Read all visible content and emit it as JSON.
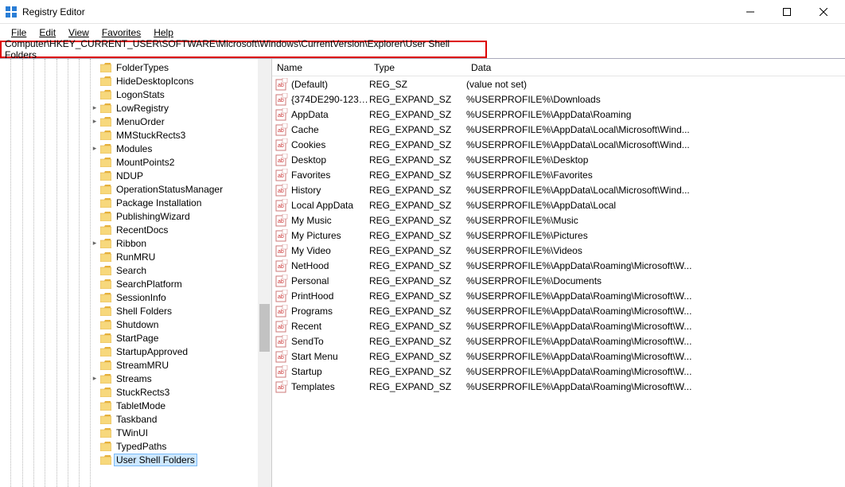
{
  "titlebar": {
    "title": "Registry Editor"
  },
  "menu": {
    "file": "File",
    "edit": "Edit",
    "view": "View",
    "favorites": "Favorites",
    "help": "Help"
  },
  "address": "Computer\\HKEY_CURRENT_USER\\SOFTWARE\\Microsoft\\Windows\\CurrentVersion\\Explorer\\User Shell Folders",
  "list": {
    "cols": {
      "name": "Name",
      "type": "Type",
      "data": "Data"
    },
    "rows": [
      {
        "name": "(Default)",
        "type": "REG_SZ",
        "data": "(value not set)"
      },
      {
        "name": "{374DE290-123F...",
        "type": "REG_EXPAND_SZ",
        "data": "%USERPROFILE%\\Downloads"
      },
      {
        "name": "AppData",
        "type": "REG_EXPAND_SZ",
        "data": "%USERPROFILE%\\AppData\\Roaming"
      },
      {
        "name": "Cache",
        "type": "REG_EXPAND_SZ",
        "data": "%USERPROFILE%\\AppData\\Local\\Microsoft\\Wind..."
      },
      {
        "name": "Cookies",
        "type": "REG_EXPAND_SZ",
        "data": "%USERPROFILE%\\AppData\\Local\\Microsoft\\Wind..."
      },
      {
        "name": "Desktop",
        "type": "REG_EXPAND_SZ",
        "data": "%USERPROFILE%\\Desktop"
      },
      {
        "name": "Favorites",
        "type": "REG_EXPAND_SZ",
        "data": "%USERPROFILE%\\Favorites"
      },
      {
        "name": "History",
        "type": "REG_EXPAND_SZ",
        "data": "%USERPROFILE%\\AppData\\Local\\Microsoft\\Wind..."
      },
      {
        "name": "Local AppData",
        "type": "REG_EXPAND_SZ",
        "data": "%USERPROFILE%\\AppData\\Local"
      },
      {
        "name": "My Music",
        "type": "REG_EXPAND_SZ",
        "data": "%USERPROFILE%\\Music"
      },
      {
        "name": "My Pictures",
        "type": "REG_EXPAND_SZ",
        "data": "%USERPROFILE%\\Pictures"
      },
      {
        "name": "My Video",
        "type": "REG_EXPAND_SZ",
        "data": "%USERPROFILE%\\Videos"
      },
      {
        "name": "NetHood",
        "type": "REG_EXPAND_SZ",
        "data": "%USERPROFILE%\\AppData\\Roaming\\Microsoft\\W..."
      },
      {
        "name": "Personal",
        "type": "REG_EXPAND_SZ",
        "data": "%USERPROFILE%\\Documents"
      },
      {
        "name": "PrintHood",
        "type": "REG_EXPAND_SZ",
        "data": "%USERPROFILE%\\AppData\\Roaming\\Microsoft\\W..."
      },
      {
        "name": "Programs",
        "type": "REG_EXPAND_SZ",
        "data": "%USERPROFILE%\\AppData\\Roaming\\Microsoft\\W..."
      },
      {
        "name": "Recent",
        "type": "REG_EXPAND_SZ",
        "data": "%USERPROFILE%\\AppData\\Roaming\\Microsoft\\W..."
      },
      {
        "name": "SendTo",
        "type": "REG_EXPAND_SZ",
        "data": "%USERPROFILE%\\AppData\\Roaming\\Microsoft\\W..."
      },
      {
        "name": "Start Menu",
        "type": "REG_EXPAND_SZ",
        "data": "%USERPROFILE%\\AppData\\Roaming\\Microsoft\\W..."
      },
      {
        "name": "Startup",
        "type": "REG_EXPAND_SZ",
        "data": "%USERPROFILE%\\AppData\\Roaming\\Microsoft\\W..."
      },
      {
        "name": "Templates",
        "type": "REG_EXPAND_SZ",
        "data": "%USERPROFILE%\\AppData\\Roaming\\Microsoft\\W..."
      }
    ]
  },
  "tree": [
    {
      "indent": 8,
      "exp": "",
      "label": "FolderTypes"
    },
    {
      "indent": 8,
      "exp": "",
      "label": "HideDesktopIcons"
    },
    {
      "indent": 8,
      "exp": "",
      "label": "LogonStats"
    },
    {
      "indent": 8,
      "exp": ">",
      "label": "LowRegistry"
    },
    {
      "indent": 8,
      "exp": ">",
      "label": "MenuOrder"
    },
    {
      "indent": 8,
      "exp": "",
      "label": "MMStuckRects3"
    },
    {
      "indent": 8,
      "exp": ">",
      "label": "Modules"
    },
    {
      "indent": 8,
      "exp": "",
      "label": "MountPoints2"
    },
    {
      "indent": 8,
      "exp": "",
      "label": "NDUP"
    },
    {
      "indent": 8,
      "exp": "",
      "label": "OperationStatusManager"
    },
    {
      "indent": 8,
      "exp": "",
      "label": "Package Installation"
    },
    {
      "indent": 8,
      "exp": "",
      "label": "PublishingWizard"
    },
    {
      "indent": 8,
      "exp": "",
      "label": "RecentDocs"
    },
    {
      "indent": 8,
      "exp": ">",
      "label": "Ribbon"
    },
    {
      "indent": 8,
      "exp": "",
      "label": "RunMRU"
    },
    {
      "indent": 8,
      "exp": "",
      "label": "Search"
    },
    {
      "indent": 8,
      "exp": "",
      "label": "SearchPlatform"
    },
    {
      "indent": 8,
      "exp": "",
      "label": "SessionInfo"
    },
    {
      "indent": 8,
      "exp": "",
      "label": "Shell Folders"
    },
    {
      "indent": 8,
      "exp": "",
      "label": "Shutdown"
    },
    {
      "indent": 8,
      "exp": "",
      "label": "StartPage"
    },
    {
      "indent": 8,
      "exp": "",
      "label": "StartupApproved"
    },
    {
      "indent": 8,
      "exp": "",
      "label": "StreamMRU"
    },
    {
      "indent": 8,
      "exp": ">",
      "label": "Streams"
    },
    {
      "indent": 8,
      "exp": "",
      "label": "StuckRects3"
    },
    {
      "indent": 8,
      "exp": "",
      "label": "TabletMode"
    },
    {
      "indent": 8,
      "exp": "",
      "label": "Taskband"
    },
    {
      "indent": 8,
      "exp": "",
      "label": "TWinUI"
    },
    {
      "indent": 8,
      "exp": "",
      "label": "TypedPaths"
    },
    {
      "indent": 8,
      "exp": "",
      "label": "User Shell Folders",
      "selected": true
    }
  ]
}
